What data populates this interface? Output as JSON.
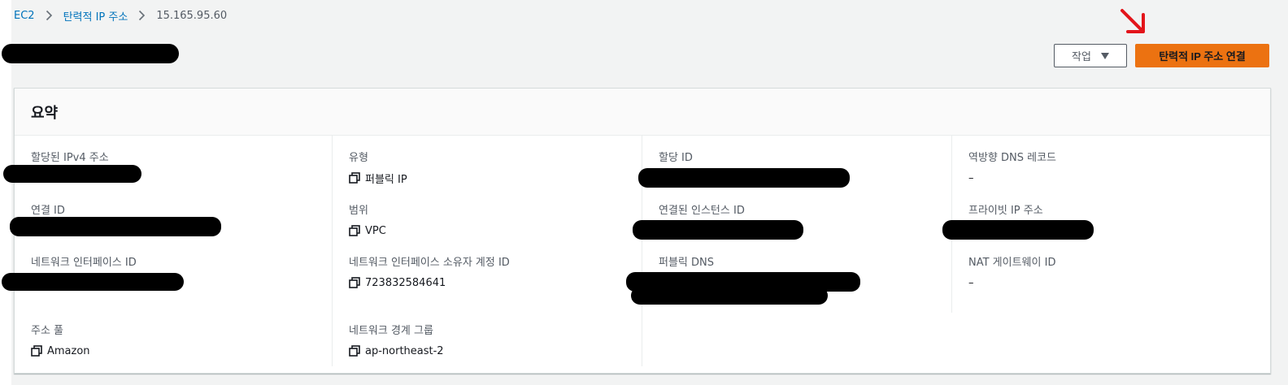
{
  "breadcrumb": {
    "items": [
      "EC2",
      "탄력적 IP 주소"
    ],
    "current": "15.165.95.60"
  },
  "header": {
    "actions_label": "작업",
    "primary_label": "탄력적 IP 주소 연결"
  },
  "summary": {
    "title": "요약",
    "col1": {
      "allocated_ipv4_label": "할당된 IPv4 주소",
      "association_id_label": "연결 ID",
      "network_interface_id_label": "네트워크 인터페이스 ID",
      "address_pool_label": "주소 풀",
      "address_pool_value": "Amazon"
    },
    "col2": {
      "type_label": "유형",
      "type_value": "퍼블릭 IP",
      "scope_label": "범위",
      "scope_value": "VPC",
      "owner_account_label": "네트워크 인터페이스 소유자 계정 ID",
      "owner_account_value": "723832584641",
      "network_border_group_label": "네트워크 경계 그룹",
      "network_border_group_value": "ap-northeast-2"
    },
    "col3": {
      "allocation_id_label": "할당 ID",
      "associated_instance_label": "연결된 인스턴스 ID",
      "public_dns_label": "퍼블릭 DNS"
    },
    "col4": {
      "reverse_dns_label": "역방향 DNS 레코드",
      "reverse_dns_value": "–",
      "private_ip_label": "프라이빗 IP 주소",
      "nat_gateway_label": "NAT 게이트웨이 ID",
      "nat_gateway_value": "–"
    }
  },
  "colors": {
    "primary": "#ec7211",
    "link": "#0073bb",
    "annotation": "#e3141a"
  },
  "icons": [
    "chevron-right-icon",
    "caret-down-icon",
    "copy-icon",
    "annotation-arrow-icon"
  ]
}
